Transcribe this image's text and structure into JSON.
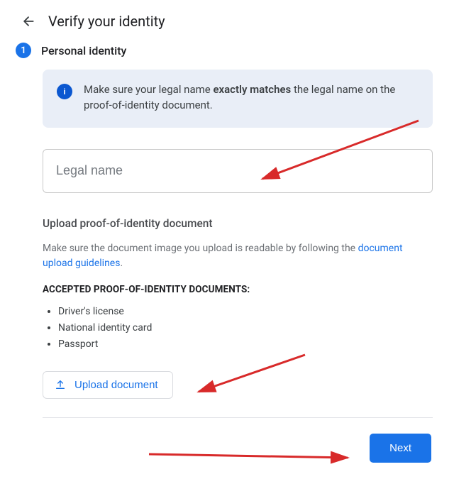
{
  "header": {
    "title": "Verify your identity"
  },
  "step": {
    "number": "1",
    "label": "Personal identity"
  },
  "info": {
    "icon_glyph": "i",
    "text_before": "Make sure your legal name ",
    "text_bold": "exactly matches",
    "text_after": " the legal name on the proof-of-identity document."
  },
  "legal_name": {
    "placeholder": "Legal name",
    "value": ""
  },
  "upload_section": {
    "heading": "Upload proof-of-identity document",
    "helper_before": "Make sure the document image you upload is readable by following the ",
    "helper_link": "document upload guidelines",
    "helper_after": ".",
    "accepted_caps": "ACCEPTED PROOF-OF-IDENTITY DOCUMENTS:",
    "accepted_list": [
      "Driver's license",
      "National identity card",
      "Passport"
    ],
    "button_label": "Upload document"
  },
  "footer": {
    "next_label": "Next"
  },
  "colors": {
    "primary": "#1a73e8",
    "annotation_arrow": "#d82a2a"
  }
}
